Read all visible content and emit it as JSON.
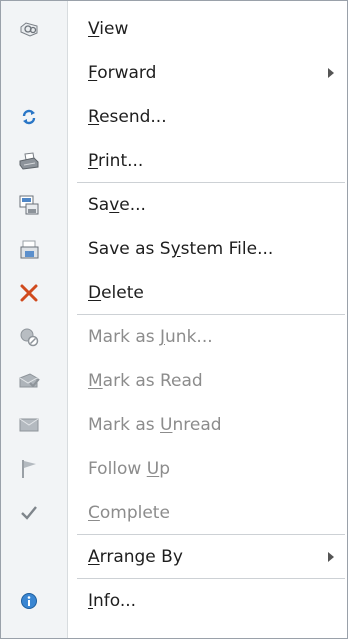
{
  "menu": {
    "items": [
      {
        "pre": "",
        "key": "V",
        "post": "iew",
        "icon": "view-icon",
        "submenu": false,
        "disabled": false
      },
      {
        "pre": "",
        "key": "F",
        "post": "orward",
        "icon": "",
        "submenu": true,
        "disabled": false
      },
      {
        "pre": "",
        "key": "R",
        "post": "esend...",
        "icon": "resend-icon",
        "submenu": false,
        "disabled": false
      },
      {
        "pre": "",
        "key": "P",
        "post": "rint...",
        "icon": "print-icon",
        "submenu": false,
        "disabled": false
      },
      {
        "pre": "Sa",
        "key": "v",
        "post": "e...",
        "icon": "save-icon",
        "submenu": false,
        "disabled": false
      },
      {
        "pre": "Save as S",
        "key": "y",
        "post": "stem File...",
        "icon": "save-system-file-icon",
        "submenu": false,
        "disabled": false
      },
      {
        "pre": "",
        "key": "D",
        "post": "elete",
        "icon": "delete-icon",
        "submenu": false,
        "disabled": false
      },
      {
        "pre": "Mark as ",
        "key": "J",
        "post": "unk...",
        "icon": "junk-icon",
        "submenu": false,
        "disabled": true
      },
      {
        "pre": "",
        "key": "M",
        "post": "ark as Read",
        "icon": "mark-read-icon",
        "submenu": false,
        "disabled": true
      },
      {
        "pre": "Mark as ",
        "key": "U",
        "post": "nread",
        "icon": "mark-unread-icon",
        "submenu": false,
        "disabled": true
      },
      {
        "pre": "Follow ",
        "key": "U",
        "post": "p",
        "icon": "follow-up-flag-icon",
        "submenu": false,
        "disabled": true
      },
      {
        "pre": "",
        "key": "C",
        "post": "omplete",
        "icon": "checkmark-icon",
        "submenu": false,
        "disabled": true
      },
      {
        "pre": "",
        "key": "A",
        "post": "rrange By",
        "icon": "",
        "submenu": true,
        "disabled": false
      },
      {
        "pre": "",
        "key": "I",
        "post": "nfo...",
        "icon": "info-icon",
        "submenu": false,
        "disabled": false
      }
    ],
    "colors": {
      "text": "#1e1e1e",
      "disabled_text": "#8c8c8c",
      "gutter": "#f2f4f6",
      "border": "#9aa1aa",
      "delete_red": "#d04a1e",
      "accent_blue": "#2a76c6"
    }
  }
}
